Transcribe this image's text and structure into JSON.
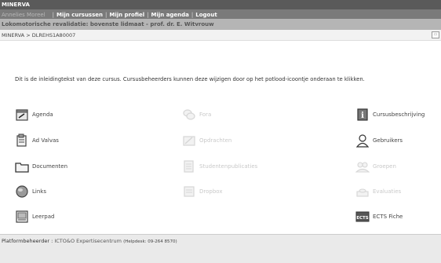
{
  "header": {
    "app_name": "MINERVA"
  },
  "nav": {
    "user": "Annelies Moreel",
    "items": [
      "Mijn cursussen",
      "Mijn profiel",
      "Mijn agenda",
      "Logout"
    ]
  },
  "course": {
    "title": "Lokomotorische revalidatie: bovenste lidmaat - prof. dr. E. Witvrouw"
  },
  "breadcrumb": {
    "text": "MINERVA > DLREHS1A80007",
    "print_icon": "print-icon"
  },
  "intro": {
    "text": "Dit is de inleidingtekst van deze cursus. Cursusbeheerders kunnen deze wijzigen door op het potlood-icoontje onderaan te klikken."
  },
  "tools": [
    {
      "label": "Agenda",
      "icon": "calendar-icon",
      "enabled": true
    },
    {
      "label": "Fora",
      "icon": "forum-icon",
      "enabled": false
    },
    {
      "label": "Cursusbeschrijving",
      "icon": "info-icon",
      "enabled": true
    },
    {
      "label": "Ad Valvas",
      "icon": "announcements-icon",
      "enabled": true
    },
    {
      "label": "Opdrachten",
      "icon": "assignment-icon",
      "enabled": false
    },
    {
      "label": "Gebruikers",
      "icon": "users-icon",
      "enabled": true
    },
    {
      "label": "Documenten",
      "icon": "folder-icon",
      "enabled": true
    },
    {
      "label": "Studentenpublicaties",
      "icon": "publications-icon",
      "enabled": false
    },
    {
      "label": "Groepen",
      "icon": "groups-icon",
      "enabled": false
    },
    {
      "label": "Links",
      "icon": "globe-icon",
      "enabled": true
    },
    {
      "label": "Dropbox",
      "icon": "dropbox-icon",
      "enabled": false
    },
    {
      "label": "Evaluaties",
      "icon": "evaluation-icon",
      "enabled": false
    },
    {
      "label": "Leerpad",
      "icon": "learning-path-icon",
      "enabled": true
    },
    {
      "label": "ECTS Fiche",
      "icon": "ects-icon",
      "enabled": true
    }
  ],
  "footer": {
    "label": "Platformbeheerder : ",
    "link": "ICTO&O Expertisecentrum",
    "helpdesk": "(Helpdesk: 09-264 8570)"
  }
}
